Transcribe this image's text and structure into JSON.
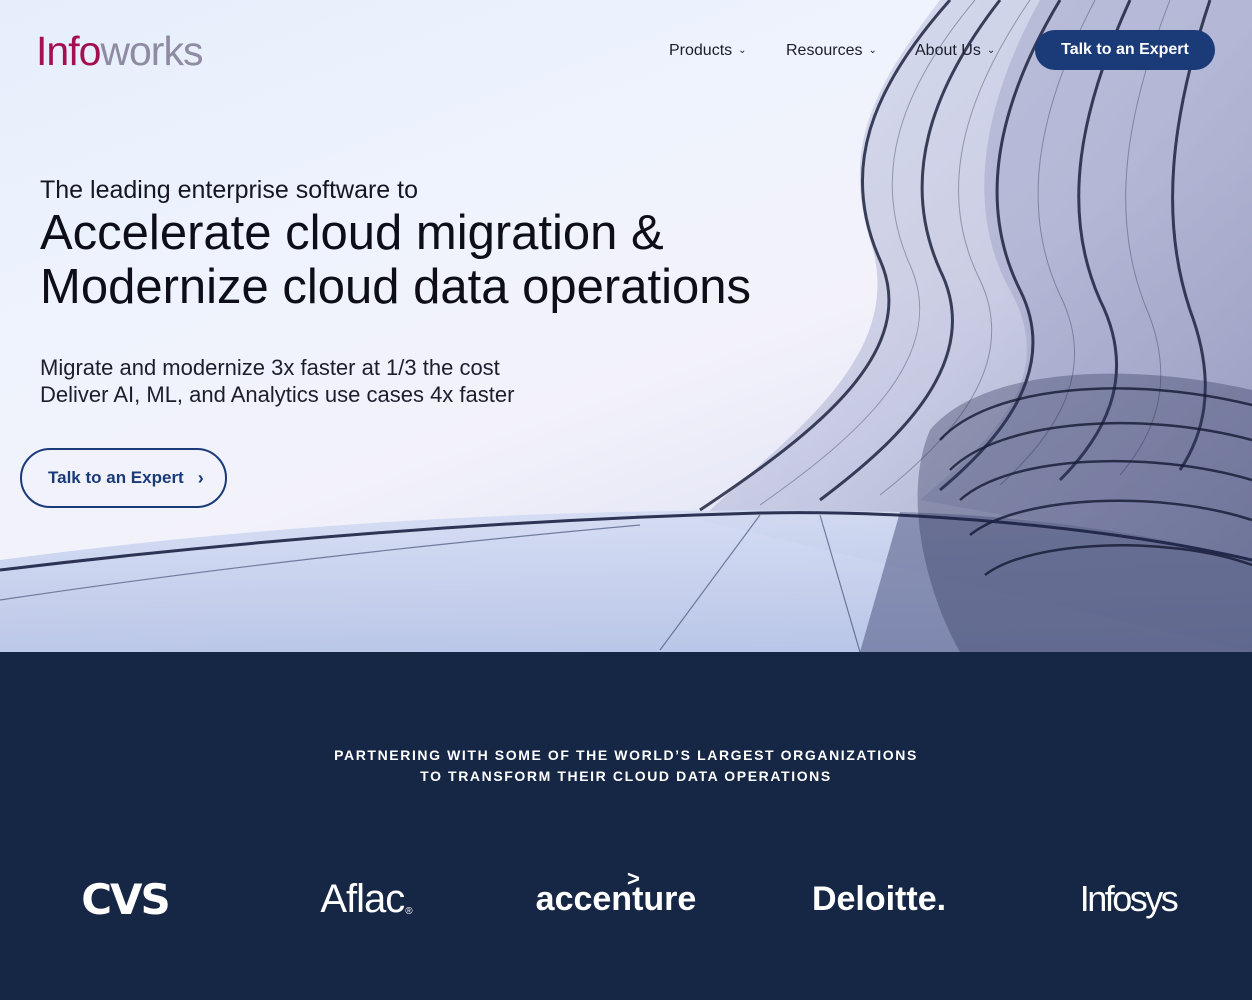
{
  "header": {
    "logo_part1": "Info",
    "logo_part2": "works",
    "nav": [
      {
        "label": "Products"
      },
      {
        "label": "Resources"
      },
      {
        "label": "About Us"
      }
    ],
    "cta_label": "Talk to an Expert"
  },
  "hero": {
    "eyebrow": "The leading enterprise software to",
    "headline_line1": "Accelerate cloud migration &",
    "headline_line2": "Modernize cloud data operations",
    "subline1": "Migrate and modernize 3x faster at 1/3 the cost",
    "subline2": "Deliver AI, ML, and Analytics use cases 4x faster",
    "cta_label": "Talk to an Expert"
  },
  "partners": {
    "heading_line1": "PARTNERING WITH SOME OF THE WORLD’S LARGEST ORGANIZATIONS",
    "heading_line2": "TO TRANSFORM THEIR CLOUD DATA OPERATIONS",
    "logos": [
      {
        "name": "CVS"
      },
      {
        "name": "Aflac"
      },
      {
        "name": "accenture"
      },
      {
        "name": "Deloitte."
      },
      {
        "name": "Infosys"
      }
    ]
  },
  "colors": {
    "brand_primary": "#1a3a78",
    "logo_info": "#a3104f",
    "logo_works": "#8f8ba3",
    "partners_bg": "#162645"
  },
  "icons": {
    "nav_dropdown": "chevron-down-icon",
    "cta_arrow": "chevron-right-icon"
  }
}
